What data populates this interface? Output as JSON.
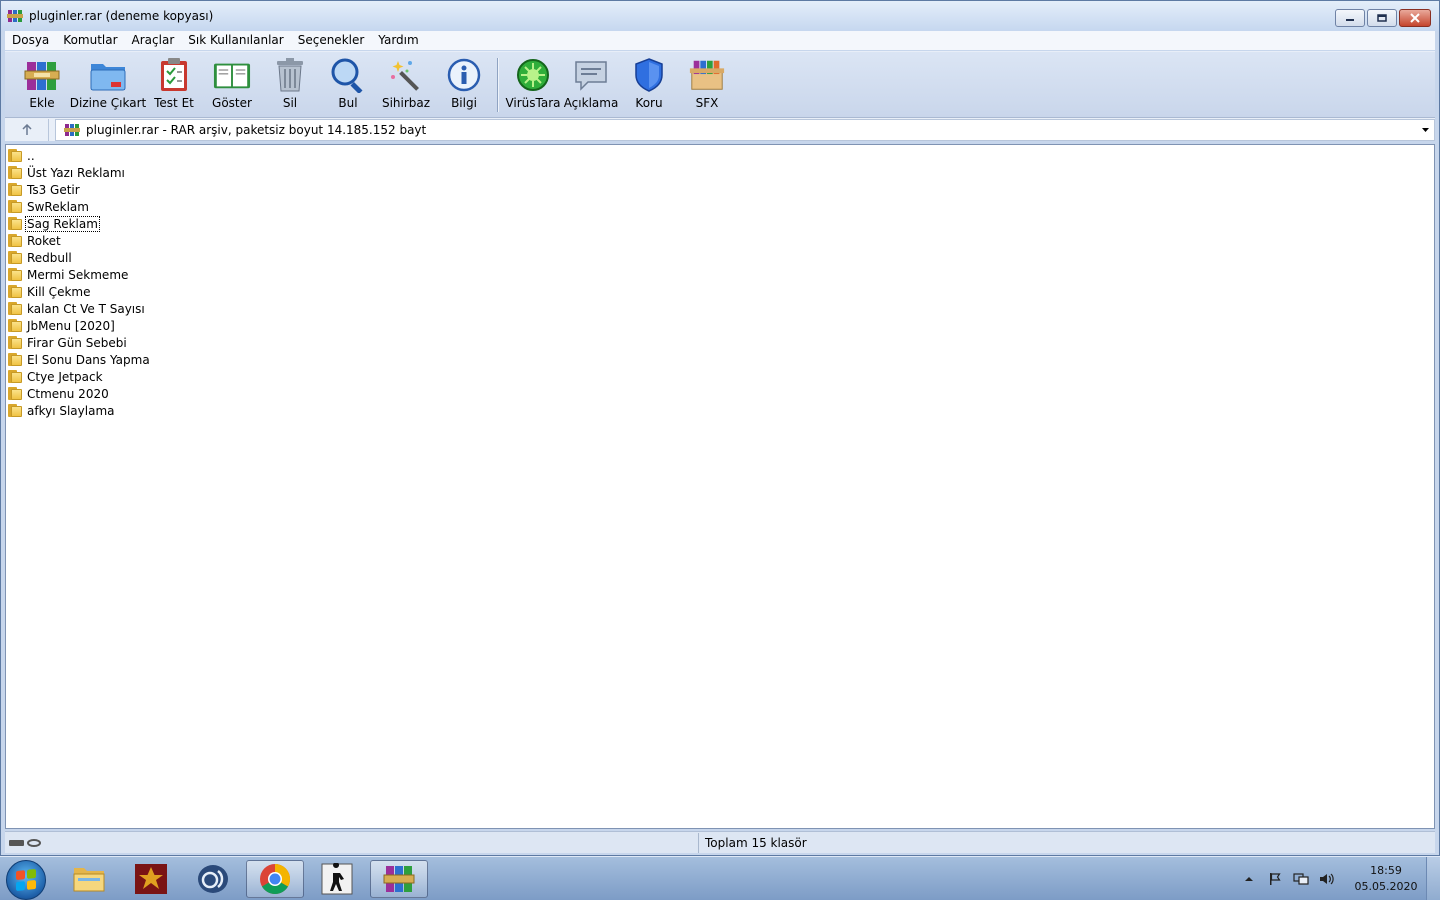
{
  "window": {
    "title": "pluginler.rar (deneme kopyası)",
    "buttons": {
      "minimize": "—",
      "maximize": "▢",
      "close": "✕"
    }
  },
  "menu": [
    "Dosya",
    "Komutlar",
    "Araçlar",
    "Sık Kullanılanlar",
    "Seçenekler",
    "Yardım"
  ],
  "toolbar": {
    "add": "Ekle",
    "extract": "Dizine Çıkart",
    "test": "Test Et",
    "view": "Göster",
    "delete": "Sil",
    "find": "Bul",
    "wizard": "Sihirbaz",
    "info": "Bilgi",
    "virus": "VirüsTara",
    "comment": "Açıklama",
    "protect": "Koru",
    "sfx": "SFX"
  },
  "address": {
    "text": "pluginler.rar - RAR arşiv, paketsiz boyut 14.185.152 bayt"
  },
  "files": [
    "..",
    "Üst Yazı Reklamı",
    "Ts3 Getir",
    "SwReklam",
    "Sag Reklam",
    "Roket",
    "Redbull",
    "Mermi Sekmeme",
    "Kill Çekme",
    "kalan Ct Ve T Sayısı",
    "JbMenu [2020]",
    "Firar Gün Sebebi",
    "El Sonu Dans Yapma",
    "Ctye Jetpack",
    "Ctmenu 2020",
    "afkyı Slaylama"
  ],
  "focused_index": 4,
  "status": {
    "summary": "Toplam 15 klasör"
  },
  "taskbar": {
    "time": "18:59",
    "date": "05.05.2020"
  },
  "colors": {
    "window_bg": "#c7d6ec",
    "taskbar_bg": "#7d9cc6",
    "folder": "#f0c345"
  }
}
